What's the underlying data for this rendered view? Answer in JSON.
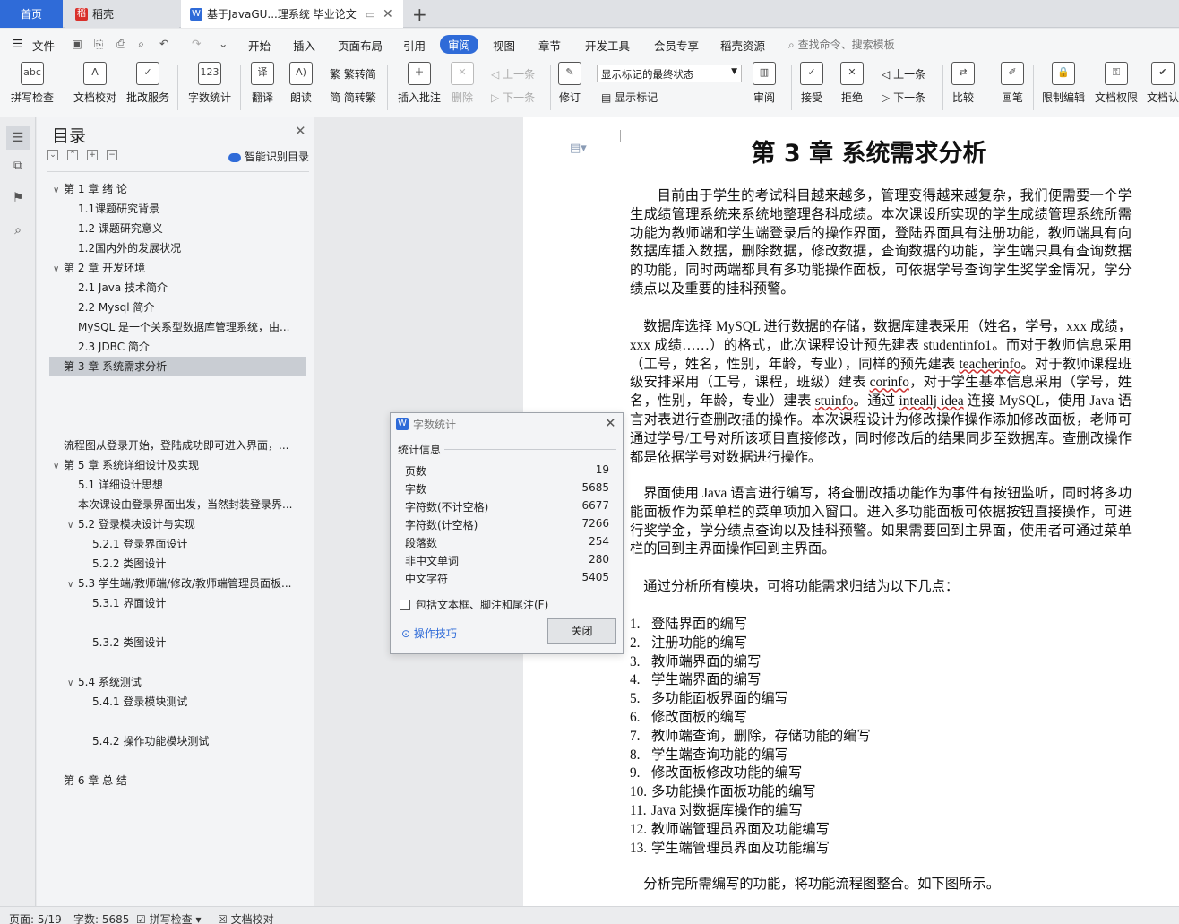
{
  "tabs": {
    "home": "首页",
    "daoke": "稻壳",
    "document": "基于JavaGU...理系统 毕业论文"
  },
  "menu": {
    "file": "文件",
    "items": [
      "开始",
      "插入",
      "页面布局",
      "引用",
      "审阅",
      "视图",
      "章节",
      "开发工具",
      "会员专享",
      "稻壳资源"
    ],
    "search": "查找命令、搜索模板"
  },
  "ribbon": {
    "spellcheck": "拼写检查",
    "doc_check": "文档校对",
    "annotate_service": "批改服务",
    "word_count": "字数统计",
    "translate": "翻译",
    "read_aloud": "朗读",
    "trad_to_simp": "繁转简",
    "simp_to_trad": "简转繁",
    "insert_comment": "插入批注",
    "delete": "删除",
    "prev": "上一条",
    "next": "下一条",
    "revise": "修订",
    "track_state": "显示标记的最终状态",
    "show_marks": "显示标记",
    "review": "审阅",
    "accept": "接受",
    "reject": "拒绝",
    "prev2": "上一条",
    "next2": "下一条",
    "compare": "比较",
    "brush": "画笔",
    "restrict_edit": "限制编辑",
    "doc_rights": "文档权限",
    "doc_auth": "文档认"
  },
  "toc": {
    "title": "目录",
    "smart": "智能识别目录",
    "items": [
      {
        "text": "第 1 章  绪    论",
        "caret": "∨"
      },
      {
        "text": "1.1课题研究背景",
        "caret": ""
      },
      {
        "text": "1.2  课题研究意义",
        "caret": ""
      },
      {
        "text": "1.2国内外的发展状况",
        "caret": ""
      },
      {
        "text": "第 2 章  开发环境",
        "caret": "∨"
      },
      {
        "text": "2.1 Java 技术简介",
        "caret": ""
      },
      {
        "text": "2.2 Mysql 简介",
        "caret": ""
      },
      {
        "text": "MySQL 是一个关系型数据库管理系统，由...",
        "caret": ""
      },
      {
        "text": "2.3 JDBC 简介",
        "caret": ""
      },
      {
        "text": "第 3 章  系统需求分析",
        "caret": ""
      },
      {
        "text": "流程图从登录开始，登陆成功即可进入界面，...",
        "caret": ""
      },
      {
        "text": "第 5 章  系统详细设计及实现",
        "caret": "∨"
      },
      {
        "text": "5.1  详细设计思想",
        "caret": ""
      },
      {
        "text": "本次课设由登录界面出发，当然封装登录界...",
        "caret": ""
      },
      {
        "text": "5.2  登录模块设计与实现",
        "caret": "∨"
      },
      {
        "text": "5.2.1 登录界面设计",
        "caret": ""
      },
      {
        "text": "5.2.2 类图设计",
        "caret": ""
      },
      {
        "text": "5.3  学生端/教师端/修改/教师端管理员面板...",
        "caret": "∨"
      },
      {
        "text": "5.3.1  界面设计",
        "caret": ""
      },
      {
        "text": "5.3.2  类图设计",
        "caret": ""
      },
      {
        "text": "5.4  系统测试",
        "caret": "∨"
      },
      {
        "text": "5.4.1  登录模块测试",
        "caret": ""
      },
      {
        "text": "5.4.2  操作功能模块测试",
        "caret": ""
      },
      {
        "text": "第 6 章  总    结",
        "caret": ""
      }
    ]
  },
  "document": {
    "chapter_title": "第 3 章  系统需求分析",
    "p1": "目前由于学生的考试科目越来越多，管理变得越来越复杂，我们便需要一个学生成绩管理系统来系统地整理各科成绩。本次课设所实现的学生成绩管理系统所需功能为教师端和学生端登录后的操作界面，登陆界面具有注册功能，教师端具有向数据库插入数据，删除数据，修改数据，查询数据的功能，学生端只具有查询数据的功能，同时两端都具有多功能操作面板，可依据学号查询学生奖学金情况，学分绩点以及重要的挂科预警。",
    "p2a": "数据库选择 MySQL 进行数据的存储，数据库建表采用（姓名，学号，xxx 成绩，xxx 成绩……）的格式，此次课程设计预先建表 studentinfo1。而对于教师信息采用（工号，姓名，性别，年龄，专业），同样的预先建表 ",
    "p2_teacher": "teacherinfo",
    "p2b": "。对于教师课程班级安排采用（工号，课程，班级）建表 ",
    "p2_cor": "corinfo",
    "p2c": "，对于学生基本信息采用（学号，姓名，性别，年龄，专业）建表 ",
    "p2_stu": "stuinfo",
    "p2d": "。通过 ",
    "p2_idea": "inteallj idea",
    "p2e": " 连接 MySQL，使用 Java 语言对表进行查删改插的操作。本次课程设计为修改操作操作添加修改面板，老师可通过学号/工号对所该项目直接修改，同时修改后的结果同步至数据库。查删改操作都是依据学号对数据进行操作。",
    "p3": "界面使用 Java 语言进行编写，将查删改插功能作为事件有按钮监听，同时将多功能面板作为菜单栏的菜单项加入窗口。进入多功能面板可依据按钮直接操作，可进行奖学金，学分绩点查询以及挂科预警。如果需要回到主界面，使用者可通过菜单栏的回到主界面操作回到主界面。",
    "p4": "通过分析所有模块，可将功能需求归结为以下几点：",
    "list": [
      {
        "n": "1.",
        "t": "登陆界面的编写"
      },
      {
        "n": "2.",
        "t": "注册功能的编写"
      },
      {
        "n": "3.",
        "t": "教师端界面的编写"
      },
      {
        "n": "4.",
        "t": "学生端界面的编写"
      },
      {
        "n": "5.",
        "t": "多功能面板界面的编写"
      },
      {
        "n": "6.",
        "t": "修改面板的编写"
      },
      {
        "n": "7.",
        "t": "教师端查询，删除，存储功能的编写"
      },
      {
        "n": "8.",
        "t": "学生端查询功能的编写"
      },
      {
        "n": "9.",
        "t": "修改面板修改功能的编写"
      },
      {
        "n": "10.",
        "t": "多功能操作面板功能的编写"
      },
      {
        "n": "11.",
        "t": "Java 对数据库操作的编写"
      },
      {
        "n": "12.",
        "t": "教师端管理员界面及功能编写"
      },
      {
        "n": "13.",
        "t": "学生端管理员界面及功能编写"
      }
    ],
    "p5": "分析完所需编写的功能，将功能流程图整合。如下图所示。"
  },
  "dialog": {
    "title": "字数统计",
    "section": "统计信息",
    "stats": [
      {
        "label": "页数",
        "value": "19"
      },
      {
        "label": "字数",
        "value": "5685"
      },
      {
        "label": "字符数(不计空格)",
        "value": "6677"
      },
      {
        "label": "字符数(计空格)",
        "value": "7266"
      },
      {
        "label": "段落数",
        "value": "254"
      },
      {
        "label": "非中文单词",
        "value": "280"
      },
      {
        "label": "中文字符",
        "value": "5405"
      }
    ],
    "include_label": "包括文本框、脚注和尾注(F)",
    "tips": "操作技巧",
    "close": "关闭"
  },
  "status": {
    "page": "页面: 5/19",
    "words": "字数: 5685",
    "spell": "拼写检查",
    "doc_check": "文档校对"
  },
  "colors": {
    "accent": "#2f6bd8",
    "toc_active": "#c9cdd3",
    "daoke_red": "#d9302b"
  }
}
